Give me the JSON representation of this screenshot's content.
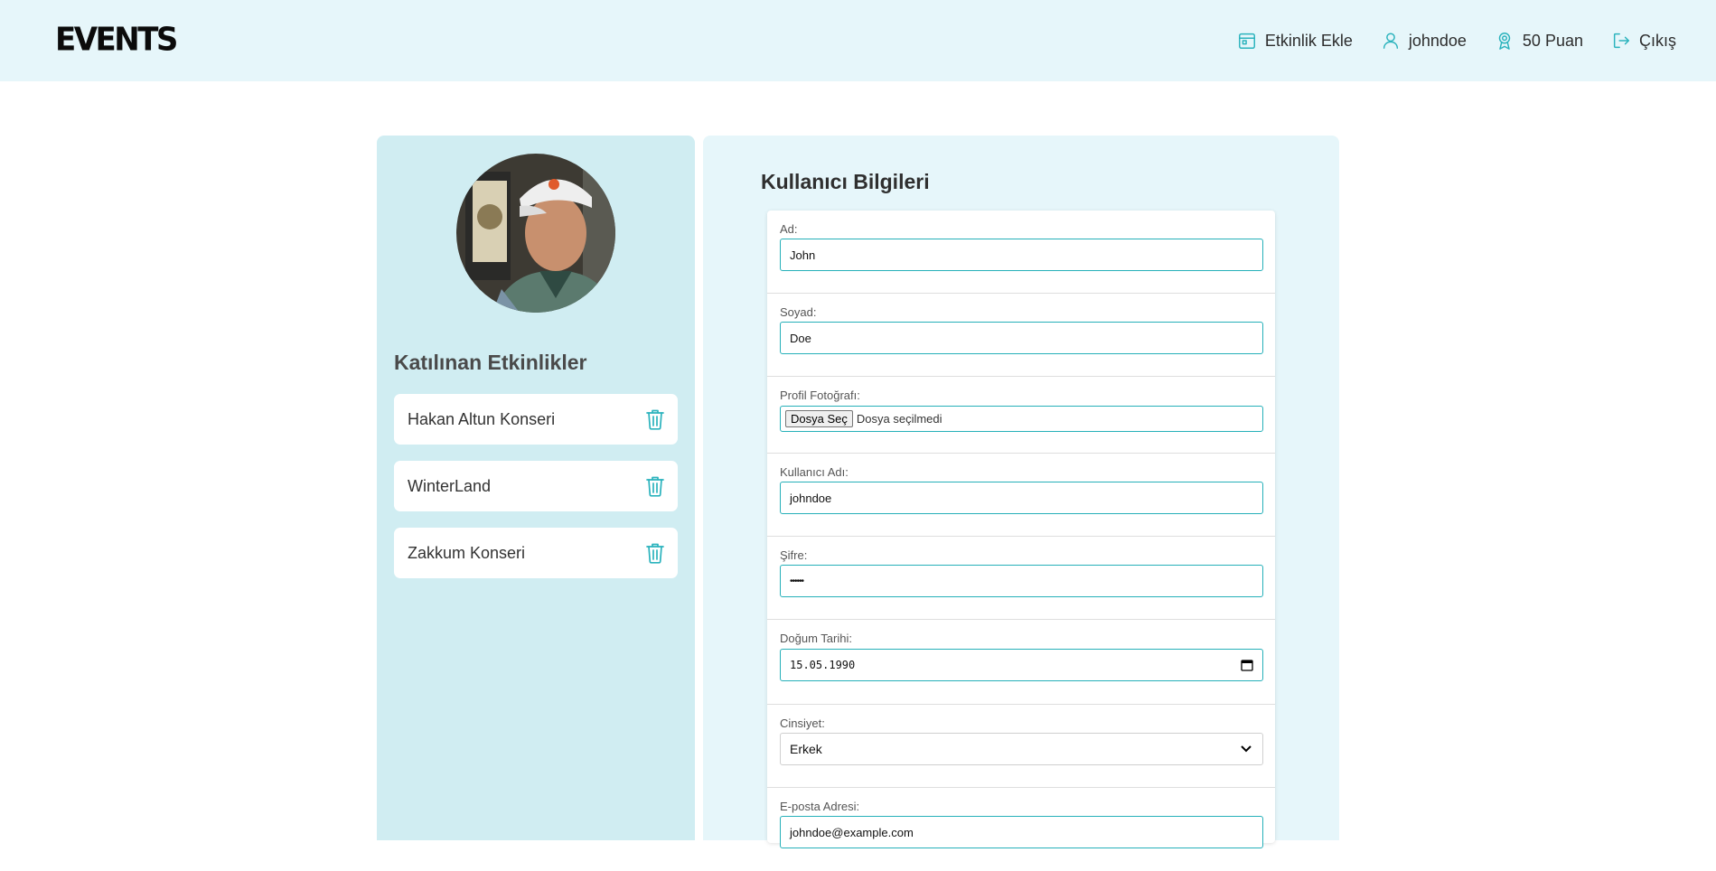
{
  "header": {
    "logo": "EVENTS",
    "nav": {
      "add_event": "Etkinlik Ekle",
      "username": "johndoe",
      "points": "50 Puan",
      "logout": "Çıkış"
    }
  },
  "sidebar": {
    "title": "Katılınan Etkinlikler",
    "events": [
      {
        "name": "Hakan Altun Konseri"
      },
      {
        "name": "WinterLand"
      },
      {
        "name": "Zakkum Konseri"
      }
    ]
  },
  "form": {
    "title": "Kullanıcı Bilgileri",
    "first_name": {
      "label": "Ad:",
      "value": "John"
    },
    "last_name": {
      "label": "Soyad:",
      "value": "Doe"
    },
    "photo": {
      "label": "Profil Fotoğrafı:",
      "button": "Dosya Seç",
      "status": "Dosya seçilmedi"
    },
    "username": {
      "label": "Kullanıcı Adı:",
      "value": "johndoe"
    },
    "password": {
      "label": "Şifre:",
      "value": "••••••"
    },
    "birth_date": {
      "label": "Doğum Tarihi:",
      "value": "15.05.1990"
    },
    "gender": {
      "label": "Cinsiyet:",
      "value": "Erkek"
    },
    "email": {
      "label": "E-posta Adresi:",
      "value": "johndoe@example.com"
    }
  }
}
